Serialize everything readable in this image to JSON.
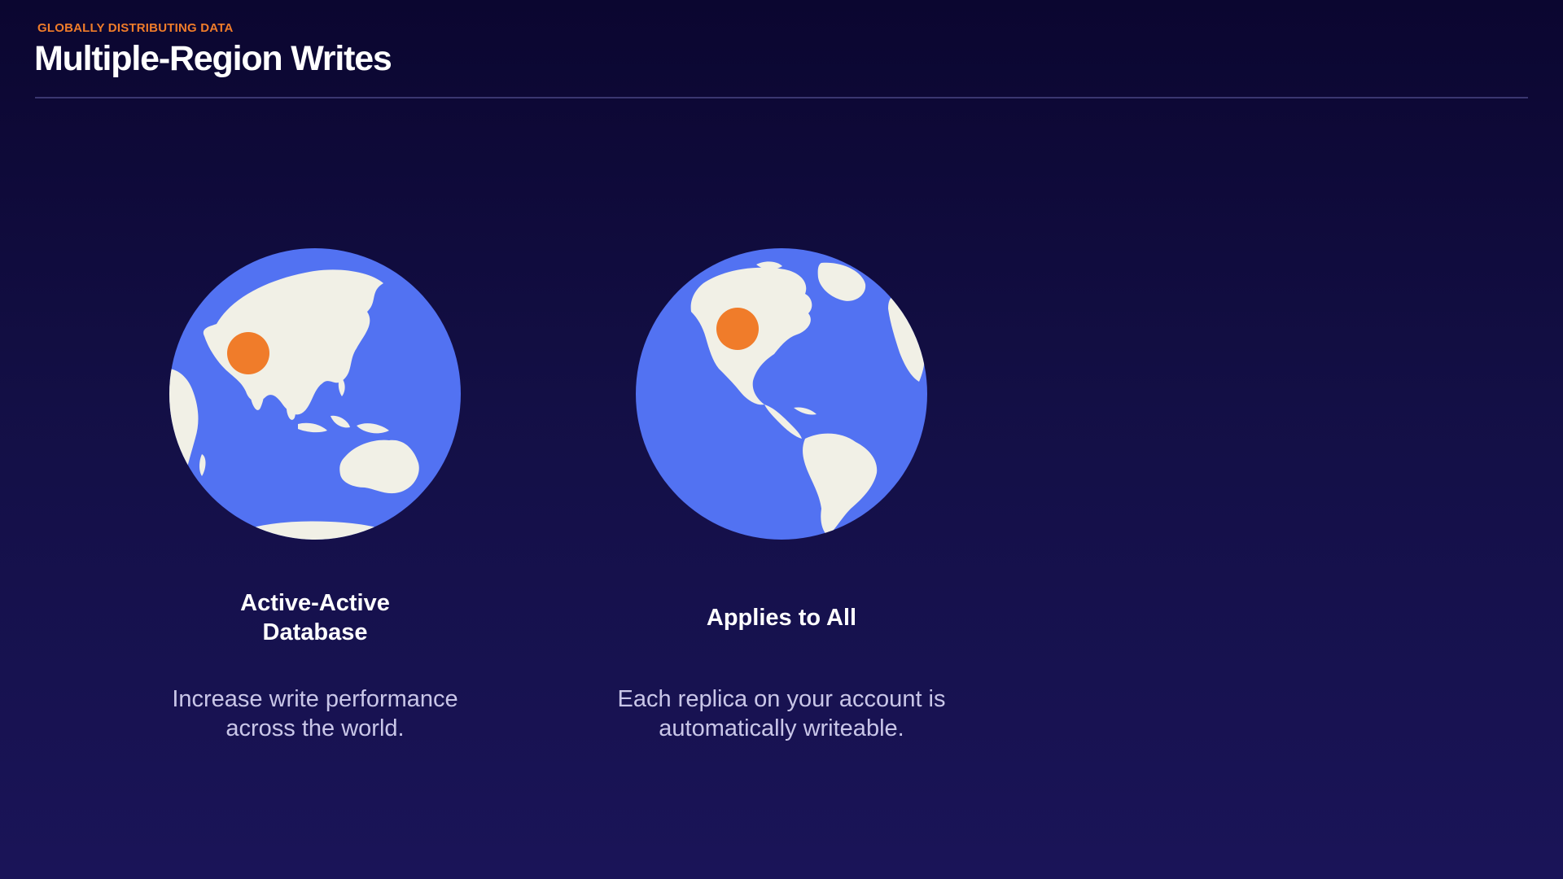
{
  "header": {
    "eyebrow": "GLOBALLY DISTRIBUTING DATA",
    "title": "Multiple-Region Writes"
  },
  "colors": {
    "accent": "#f07c2a",
    "ocean": "#5272f2",
    "land": "#f1f0e6",
    "background": "#130f45"
  },
  "cards": [
    {
      "icon": "globe-asia-icon",
      "title_line1": "Active-Active",
      "title_line2": "Database",
      "desc_line1": "Increase write performance",
      "desc_line2": "across the world."
    },
    {
      "icon": "globe-americas-icon",
      "title_line1": "Applies to All",
      "title_line2": "",
      "desc_line1": "Each replica on your account is",
      "desc_line2": "automatically writeable."
    }
  ]
}
